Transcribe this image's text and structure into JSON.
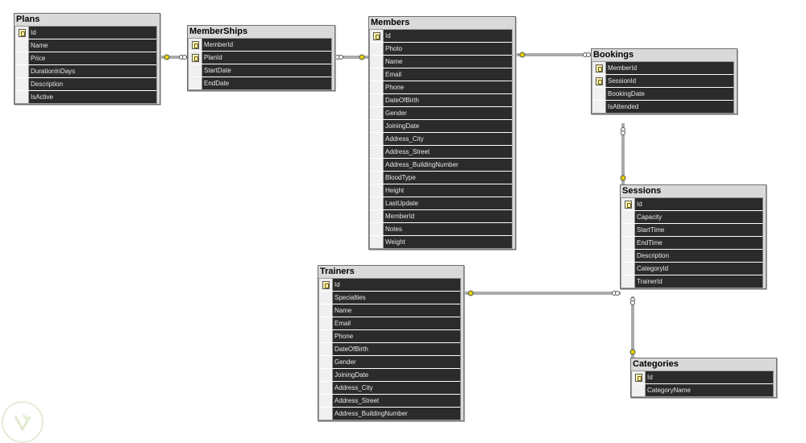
{
  "tables": {
    "plans": {
      "title": "Plans",
      "columns": [
        {
          "name": "Id",
          "key": true
        },
        {
          "name": "Name",
          "key": false
        },
        {
          "name": "Price",
          "key": false
        },
        {
          "name": "DurationInDays",
          "key": false
        },
        {
          "name": "Description",
          "key": false
        },
        {
          "name": "IsActive",
          "key": false
        }
      ]
    },
    "memberships": {
      "title": "MemberShips",
      "columns": [
        {
          "name": "MemberId",
          "key": true
        },
        {
          "name": "PlanId",
          "key": true
        },
        {
          "name": "StartDate",
          "key": false
        },
        {
          "name": "EndDate",
          "key": false
        }
      ]
    },
    "members": {
      "title": "Members",
      "columns": [
        {
          "name": "Id",
          "key": true
        },
        {
          "name": "Photo",
          "key": false
        },
        {
          "name": "Name",
          "key": false
        },
        {
          "name": "Email",
          "key": false
        },
        {
          "name": "Phone",
          "key": false
        },
        {
          "name": "DateOfBirth",
          "key": false
        },
        {
          "name": "Gender",
          "key": false
        },
        {
          "name": "JoiningDate",
          "key": false
        },
        {
          "name": "Address_City",
          "key": false
        },
        {
          "name": "Address_Street",
          "key": false
        },
        {
          "name": "Address_BuildingNumber",
          "key": false
        },
        {
          "name": "BloodType",
          "key": false
        },
        {
          "name": "Height",
          "key": false
        },
        {
          "name": "LastUpdate",
          "key": false
        },
        {
          "name": "MemberId",
          "key": false
        },
        {
          "name": "Notes",
          "key": false
        },
        {
          "name": "Weight",
          "key": false
        }
      ]
    },
    "bookings": {
      "title": "Bookings",
      "columns": [
        {
          "name": "MemberId",
          "key": true
        },
        {
          "name": "SessionId",
          "key": true
        },
        {
          "name": "BookingDate",
          "key": false
        },
        {
          "name": "IsAttended",
          "key": false
        }
      ]
    },
    "sessions": {
      "title": "Sessions",
      "columns": [
        {
          "name": "Id",
          "key": true
        },
        {
          "name": "Capacity",
          "key": false
        },
        {
          "name": "StartTime",
          "key": false
        },
        {
          "name": "EndTime",
          "key": false
        },
        {
          "name": "Description",
          "key": false
        },
        {
          "name": "CategoryId",
          "key": false
        },
        {
          "name": "TrainerId",
          "key": false
        }
      ]
    },
    "trainers": {
      "title": "Trainers",
      "columns": [
        {
          "name": "Id",
          "key": true
        },
        {
          "name": "Specialties",
          "key": false
        },
        {
          "name": "Name",
          "key": false
        },
        {
          "name": "Email",
          "key": false
        },
        {
          "name": "Phone",
          "key": false
        },
        {
          "name": "DateOfBirth",
          "key": false
        },
        {
          "name": "Gender",
          "key": false
        },
        {
          "name": "JoiningDate",
          "key": false
        },
        {
          "name": "Address_City",
          "key": false
        },
        {
          "name": "Address_Street",
          "key": false
        },
        {
          "name": "Address_BuildingNumber",
          "key": false
        }
      ]
    },
    "categories": {
      "title": "Categories",
      "columns": [
        {
          "name": "Id",
          "key": true
        },
        {
          "name": "CategoryName",
          "key": false
        }
      ]
    }
  },
  "relationships": [
    {
      "from": "plans",
      "to": "memberships",
      "one_end": "plans",
      "many_end": "memberships"
    },
    {
      "from": "memberships",
      "to": "members",
      "one_end": "members",
      "many_end": "memberships"
    },
    {
      "from": "members",
      "to": "bookings",
      "one_end": "members",
      "many_end": "bookings"
    },
    {
      "from": "bookings",
      "to": "sessions",
      "one_end": "sessions",
      "many_end": "bookings"
    },
    {
      "from": "trainers",
      "to": "sessions",
      "one_end": "trainers",
      "many_end": "sessions"
    },
    {
      "from": "sessions",
      "to": "categories",
      "one_end": "categories",
      "many_end": "sessions"
    }
  ],
  "colors": {
    "row_fill": "#2b2b2b",
    "row_text": "#e8e8e8",
    "frame": "#d9d9d9",
    "connector": "#555555",
    "key_marker": "#e8d200"
  }
}
